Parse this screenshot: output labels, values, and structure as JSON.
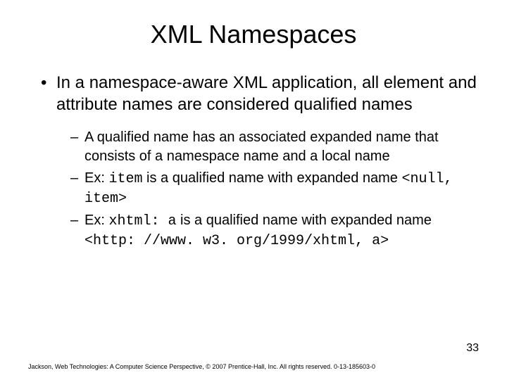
{
  "title": "XML Namespaces",
  "bullet1": {
    "pre": "In a ",
    "em1": "namespace-aware",
    "mid": " XML application, all element and attribute names are considered ",
    "em2": "qualified names"
  },
  "sub": [
    {
      "pre": "A qualified name has an associated ",
      "em1": "expanded name",
      "mid": " that consists of a namespace name and a ",
      "em2": "local name"
    },
    {
      "pre": "Ex: ",
      "code1": "item",
      "mid1": " is a qualified name with expanded name ",
      "code2": "<null, item>"
    },
    {
      "pre": "Ex: ",
      "code1": "xhtml: a",
      "mid1": " is a qualified name with expanded name ",
      "code2": "<http: //www. w3. org/1999/xhtml, a>"
    }
  ],
  "pagenum": "33",
  "footer": "Jackson, Web Technologies: A Computer Science Perspective, © 2007 Prentice-Hall, Inc. All rights reserved. 0-13-185603-0"
}
